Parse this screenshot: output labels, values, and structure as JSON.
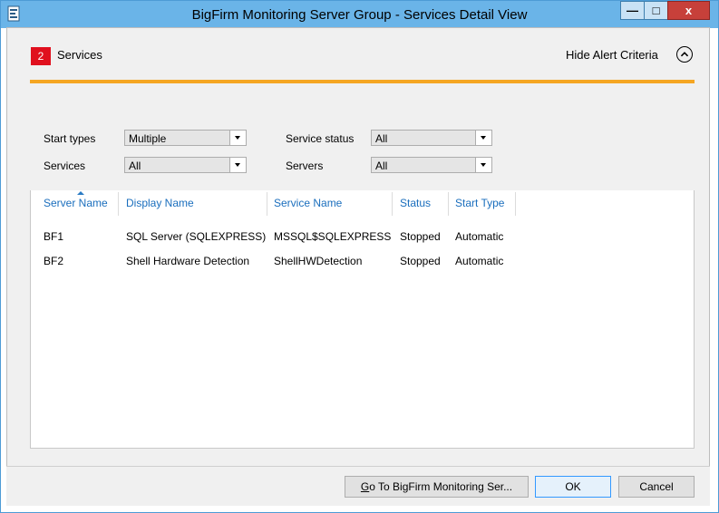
{
  "window": {
    "title": "BigFirm Monitoring Server Group - Services Detail View",
    "minimize_glyph": "—",
    "maximize_glyph": "□",
    "close_glyph": "x"
  },
  "header": {
    "count": "2",
    "label": "Services",
    "hide_alert_criteria": "Hide Alert Criteria"
  },
  "filters": {
    "start_types_label": "Start types",
    "start_types_value": "Multiple",
    "services_label": "Services",
    "services_value": "All",
    "service_status_label": "Service status",
    "service_status_value": "All",
    "servers_label": "Servers",
    "servers_value": "All"
  },
  "table": {
    "columns": [
      "Server Name",
      "Display Name",
      "Service Name",
      "Status",
      "Start Type"
    ],
    "rows": [
      [
        "BF1",
        "SQL Server (SQLEXPRESS)",
        "MSSQL$SQLEXPRESS",
        "Stopped",
        "Automatic"
      ],
      [
        "BF2",
        "Shell Hardware Detection",
        "ShellHWDetection",
        "Stopped",
        "Automatic"
      ]
    ]
  },
  "buttons": {
    "goto_mnemonic": "G",
    "goto_rest": "o To BigFirm Monitoring Ser...",
    "ok": "OK",
    "cancel": "Cancel"
  },
  "colors": {
    "titlebar": "#6ab4e8",
    "badge": "#e0101e",
    "accent_bar": "#f5a623",
    "header_text": "#1a6ebd"
  }
}
